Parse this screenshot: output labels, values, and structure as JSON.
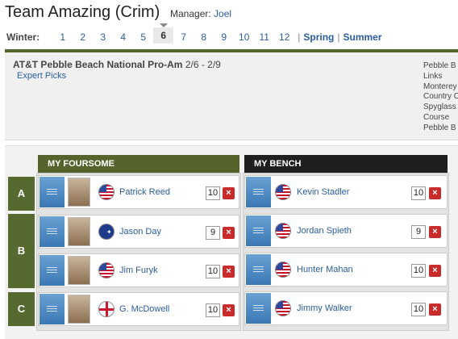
{
  "header": {
    "team_name": "Team Amazing (Crim)",
    "manager_label": "Manager:",
    "manager_name": "Joel"
  },
  "weeks": {
    "season_label": "Winter:",
    "items": [
      "1",
      "2",
      "3",
      "4",
      "5",
      "6",
      "7",
      "8",
      "9",
      "10",
      "11",
      "12"
    ],
    "selected": "6",
    "seasons": [
      "Spring",
      "Summer"
    ]
  },
  "event": {
    "name": "AT&T Pebble Beach National Pro-Am",
    "dates": "2/6 - 2/9",
    "expert_picks": "Expert Picks",
    "courses_text": [
      "Pebble B",
      "Links",
      "Monterey",
      "Country C",
      "Spyglass",
      "Course",
      "Pebble B"
    ]
  },
  "foursome": {
    "title": "MY FOURSOME",
    "header_color": "#55632c",
    "players": [
      {
        "group": "A",
        "name": "Patrick Reed",
        "flag": "us-flag-icon",
        "count": "10"
      },
      {
        "group": "B",
        "name": "Jason Day",
        "flag": "australia-flag-icon",
        "count": "9"
      },
      {
        "group": "B",
        "name": "Jim Furyk",
        "flag": "us-flag-icon",
        "count": "10"
      },
      {
        "group": "C",
        "name": "G. McDowell",
        "flag": "northern-ireland-flag-icon",
        "count": "10"
      }
    ]
  },
  "bench": {
    "title": "MY BENCH",
    "header_color": "#1f1f1f",
    "players": [
      {
        "name": "Kevin Stadler",
        "flag": "us-flag-icon",
        "count": "10"
      },
      {
        "name": "Jordan Spieth",
        "flag": "us-flag-icon",
        "count": "9"
      },
      {
        "name": "Hunter Mahan",
        "flag": "us-flag-icon",
        "count": "10"
      },
      {
        "name": "Jimmy Walker",
        "flag": "us-flag-icon",
        "count": "10"
      }
    ]
  },
  "groups": [
    "A",
    "B",
    "C"
  ],
  "icons": {
    "remove": "×"
  }
}
